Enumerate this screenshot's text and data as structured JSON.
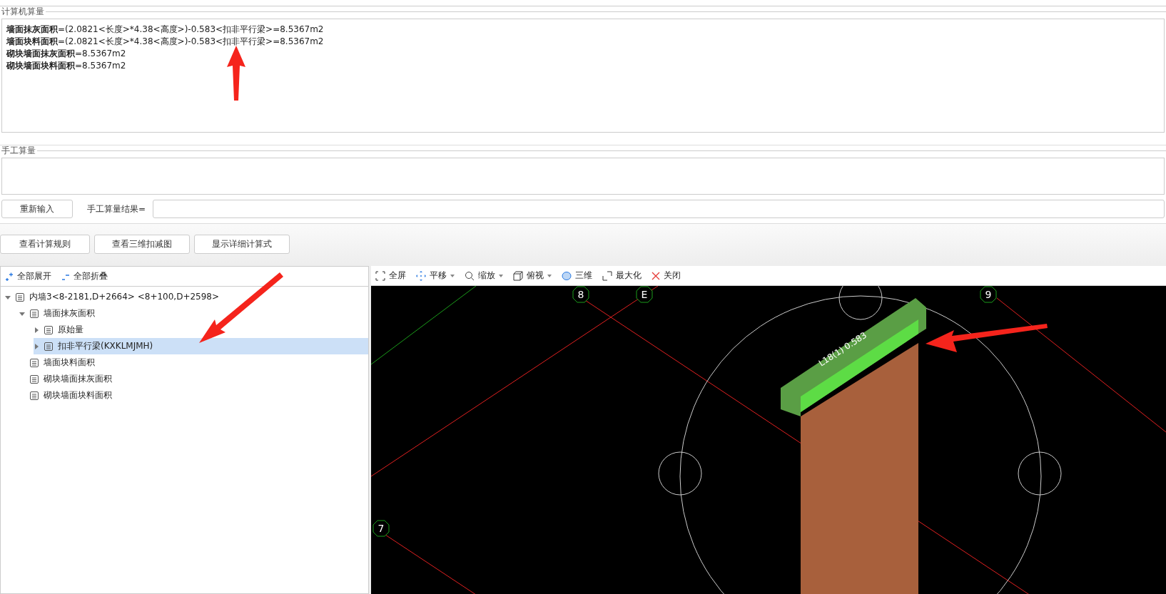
{
  "computer_calc": {
    "legend": "计算机算量",
    "lines": [
      "**墙面抹灰面积**=(2.0821<长度>*4.38<高度>)-0.583<扣非平行梁>=8.5367m2",
      "**墙面块料面积**=(2.0821<长度>*4.38<高度>)-0.583<扣非平行梁>=8.5367m2",
      "**砌块墙面抹灰面积**=8.5367m2",
      "**砌块墙面块料面积**=8.5367m2"
    ]
  },
  "manual_calc": {
    "legend": "手工算量",
    "reinput_button": "重新输入",
    "result_label": "手工算量结果="
  },
  "actions": [
    "查看计算规则",
    "查看三维扣减图",
    "显示详细计算式"
  ],
  "tree_toolbar": [
    {
      "kind": "expand",
      "label": "全部展开"
    },
    {
      "kind": "collapse",
      "label": "全部折叠"
    }
  ],
  "tree": [
    {
      "kind": "node",
      "label": "内墙3<8-2181,D+2664> <8+100,D+2598>",
      "expanded": true,
      "selected": false,
      "children": [
        {
          "kind": "node",
          "label": "墙面抹灰面积",
          "expanded": true,
          "selected": false,
          "children": [
            {
              "kind": "node",
              "label": "原始量",
              "expanded": false,
              "selected": false
            },
            {
              "kind": "node",
              "label": "扣非平行梁(KXKLMJMH)",
              "expanded": false,
              "selected": true
            }
          ]
        },
        {
          "kind": "leaf",
          "label": "墙面块料面积",
          "selected": false
        },
        {
          "kind": "leaf",
          "label": "砌块墙面抹灰面积",
          "selected": false
        },
        {
          "kind": "leaf",
          "label": "砌块墙面块料面积",
          "selected": false
        }
      ]
    }
  ],
  "viewer_toolbar": [
    {
      "kind": "fullscreen",
      "label": "全屏",
      "dropdown": false
    },
    {
      "kind": "pan",
      "label": "平移",
      "dropdown": true
    },
    {
      "kind": "zoom",
      "label": "缩放",
      "dropdown": true
    },
    {
      "kind": "top_view",
      "label": "俯视",
      "dropdown": true
    },
    {
      "kind": "perspective",
      "label": "三维",
      "dropdown": false
    },
    {
      "kind": "maximize",
      "label": "最大化",
      "dropdown": false
    },
    {
      "kind": "close",
      "label": "关闭",
      "dropdown": false
    }
  ],
  "canvas": {
    "axis_labels": [
      "8",
      "E",
      "9",
      "7"
    ],
    "beam_label": "L18(1) 0.583"
  }
}
